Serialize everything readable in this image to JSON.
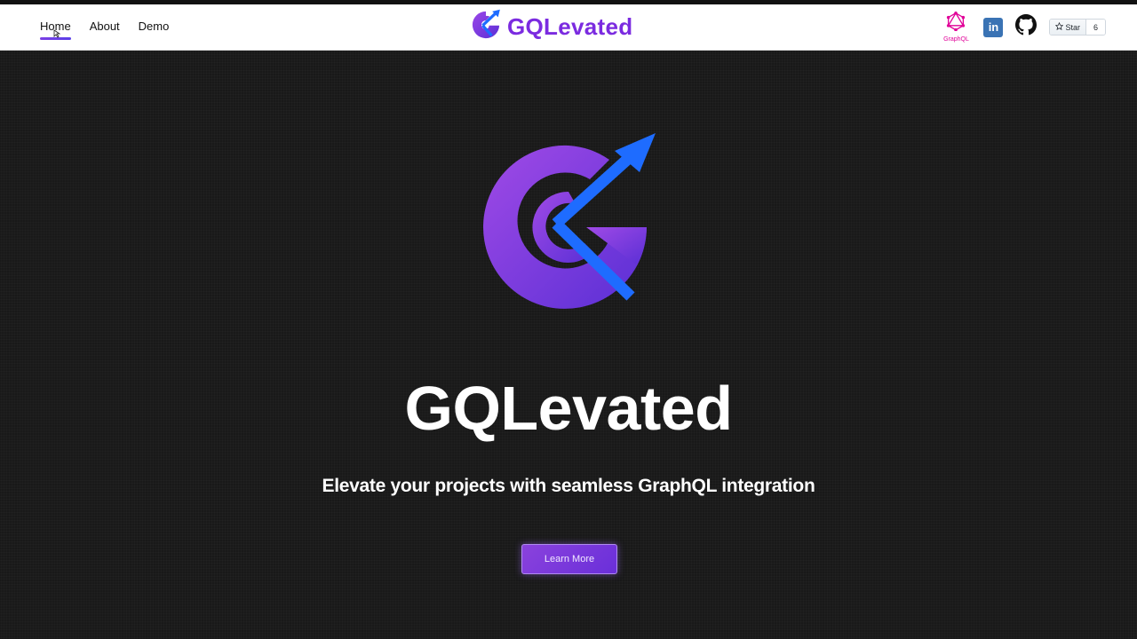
{
  "nav": {
    "links": [
      {
        "label": "Home",
        "active": true
      },
      {
        "label": "About",
        "active": false
      },
      {
        "label": "Demo",
        "active": false
      }
    ]
  },
  "brand": {
    "name": "GQLevated"
  },
  "social": {
    "graphql_label": "GraphQL",
    "linkedin_label": "in",
    "github_star_label": "Star",
    "github_star_count": "6"
  },
  "hero": {
    "title": "GQLevated",
    "subtitle": "Elevate your projects with seamless GraphQL integration",
    "cta_label": "Learn More"
  },
  "colors": {
    "accent_purple": "#7b2be0",
    "accent_blue": "#1e6cff",
    "graphql_pink": "#e10098",
    "background": "#191919"
  },
  "icons": {
    "brand": "gqlevated-logo-icon",
    "graphql": "graphql-icon",
    "linkedin": "linkedin-icon",
    "github": "github-icon",
    "star": "star-icon"
  }
}
